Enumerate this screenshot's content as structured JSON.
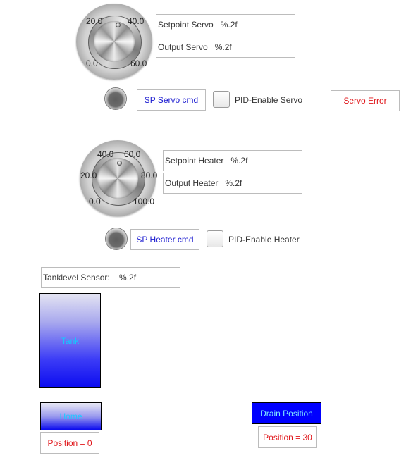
{
  "servo": {
    "knob_ticks": [
      "20.0",
      "40.0",
      "0.0",
      "60.0"
    ],
    "setpoint_label": "Setpoint Servo   %.2f",
    "output_label": "Output Servo   %.2f",
    "cmd_button": "SP Servo cmd",
    "pid_enable_label": "PID-Enable Servo",
    "error_label": "Servo Error"
  },
  "heater": {
    "knob_ticks": [
      "40.0",
      "60.0",
      "20.0",
      "80.0",
      "0.0",
      "100.0"
    ],
    "setpoint_label": "Setpoint Heater   %.2f",
    "output_label": "Output Heater   %.2f",
    "cmd_button": "SP Heater cmd",
    "pid_enable_label": "PID-Enable Heater"
  },
  "tank": {
    "sensor_label": "Tanklevel Sensor:    %.2f",
    "label": "Tank"
  },
  "home": {
    "button": "Home",
    "position": "Position = 0"
  },
  "drain": {
    "button": "Drain Position",
    "position": "Position = 30"
  },
  "colors": {
    "accent_text": "#1a1ad0",
    "error_text": "#e0161a",
    "tank_fill": "#0b0bf0",
    "tank_text": "#14c8ff"
  }
}
